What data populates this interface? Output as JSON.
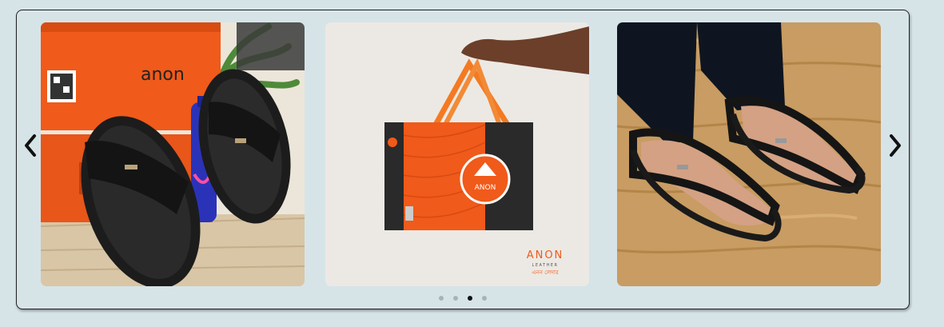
{
  "carousel": {
    "prev_icon": "chevron-left-icon",
    "next_icon": "chevron-right-icon",
    "slides": [
      {
        "alt": "Black leather sandals with orange Anon box",
        "brand_text": "anon"
      },
      {
        "alt": "Anon Leather shopping bag",
        "brand_text": "ANON",
        "sub_text": "LEATHER",
        "tag_text": "এনন লেদার"
      },
      {
        "alt": "Person wearing black leather sandals"
      }
    ],
    "dots": {
      "count": 4,
      "active_index": 2
    },
    "colors": {
      "background": "#d6e4e8",
      "accent_orange": "#f05a1a",
      "dot_inactive": "#a9b3b6",
      "dot_active": "#111111"
    }
  }
}
